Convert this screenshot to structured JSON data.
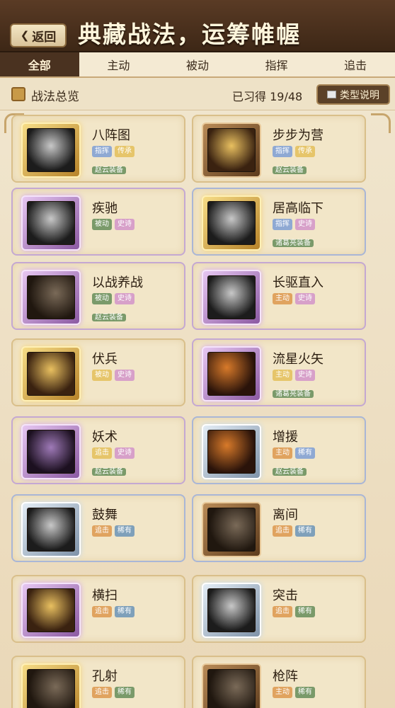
{
  "header": {
    "back_label": "返回",
    "title": "典藏战法，运筹帷幄"
  },
  "tabs": [
    {
      "label": "全部",
      "active": true
    },
    {
      "label": "主动",
      "active": false
    },
    {
      "label": "被动",
      "active": false
    },
    {
      "label": "指挥",
      "active": false
    },
    {
      "label": "追击",
      "active": false
    }
  ],
  "summary": {
    "title": "战法总览",
    "learned": "已习得 19/48",
    "type_button": "类型说明"
  },
  "cards": [
    {
      "name": "八阵图",
      "tags": [
        "指挥",
        "传承"
      ],
      "equip": "赵云装备"
    },
    {
      "name": "步步为营",
      "tags": [
        "指挥",
        "传承"
      ],
      "equip": "赵云装备"
    },
    {
      "name": "疾驰",
      "tags": [
        "被动",
        "史诗"
      ],
      "equip": ""
    },
    {
      "name": "居高临下",
      "tags": [
        "指挥",
        "史诗"
      ],
      "equip": "诸葛亮装备"
    },
    {
      "name": "以战养战",
      "tags": [
        "被动",
        "史诗"
      ],
      "equip": "赵云装备"
    },
    {
      "name": "长驱直入",
      "tags": [
        "主动",
        "史诗"
      ],
      "equip": ""
    },
    {
      "name": "伏兵",
      "tags": [
        "被动",
        "史诗"
      ],
      "equip": ""
    },
    {
      "name": "流星火矢",
      "tags": [
        "主动",
        "史诗"
      ],
      "equip": "诸葛亮装备"
    },
    {
      "name": "妖术",
      "tags": [
        "追击",
        "史诗"
      ],
      "equip": "赵云装备"
    },
    {
      "name": "增援",
      "tags": [
        "主动",
        "稀有"
      ],
      "equip": "赵云装备"
    },
    {
      "name": "鼓舞",
      "tags": [
        "追击",
        "稀有"
      ],
      "equip": ""
    },
    {
      "name": "离间",
      "tags": [
        "追击",
        "稀有"
      ],
      "equip": ""
    },
    {
      "name": "横扫",
      "tags": [
        "追击",
        "稀有"
      ],
      "equip": ""
    },
    {
      "name": "突击",
      "tags": [
        "追击",
        "稀有"
      ],
      "equip": ""
    },
    {
      "name": "孔射",
      "tags": [
        "追击",
        "稀有"
      ],
      "equip": ""
    },
    {
      "name": "枪阵",
      "tags": [
        "主动",
        "稀有"
      ],
      "equip": ""
    }
  ]
}
